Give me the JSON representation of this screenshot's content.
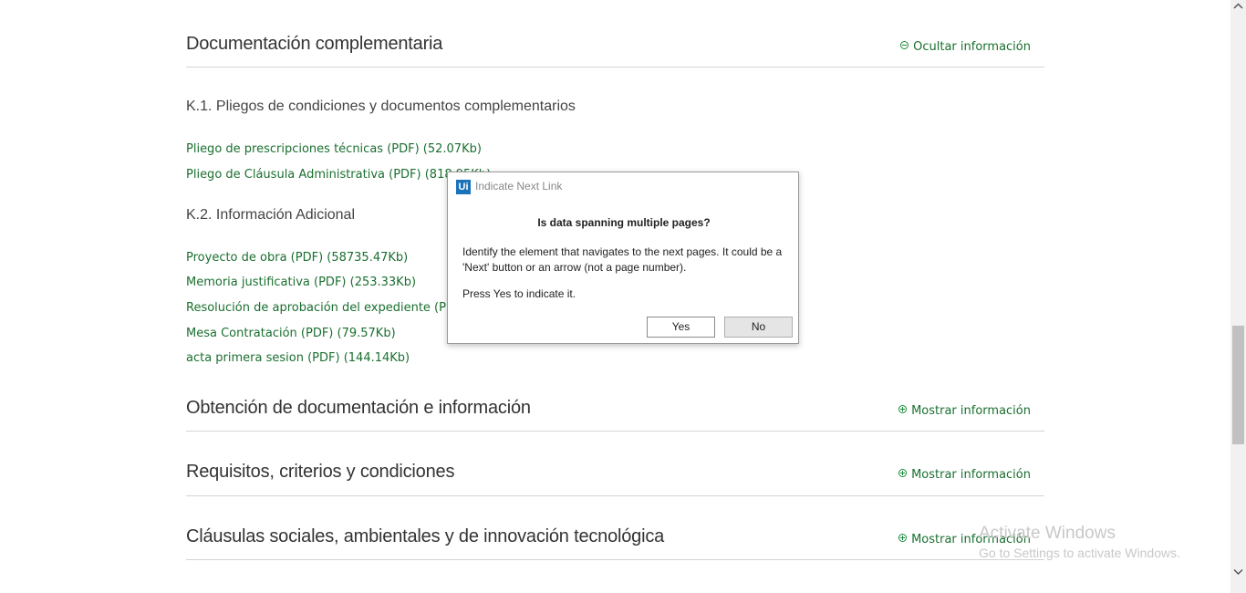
{
  "sections": {
    "documentacion": {
      "title": "Documentación complementaria",
      "toggle": "Ocultar información",
      "k1": {
        "title": "K.1. Pliegos de condiciones y documentos complementarios",
        "links": [
          "Pliego de prescripciones técnicas (PDF) (52.07Kb)",
          "Pliego de Cláusula Administrativa (PDF) (818.95Kb)"
        ]
      },
      "k2": {
        "title": "K.2. Información Adicional",
        "links": [
          "Proyecto de obra (PDF) (58735.47Kb)",
          "Memoria justificativa (PDF) (253.33Kb)",
          "Resolución de aprobación del expediente (PDF)",
          "Mesa Contratación (PDF) (79.57Kb)",
          "acta primera sesion (PDF) (144.14Kb)"
        ]
      }
    },
    "obtencion": {
      "title": "Obtención de documentación e información",
      "toggle": "Mostrar información"
    },
    "requisitos": {
      "title": "Requisitos, criterios y condiciones",
      "toggle": "Mostrar información"
    },
    "clausulas": {
      "title": "Cláusulas sociales, ambientales y de innovación tecnológica",
      "toggle": "Mostrar información"
    }
  },
  "dialog": {
    "logo": "Ui",
    "title": "Indicate Next Link",
    "question": "Is data spanning multiple pages?",
    "body": "Identify the element that navigates to the next pages. It could be a 'Next' button or an arrow (not a page number).",
    "press": "Press Yes to indicate it.",
    "yes_label": "Yes",
    "no_label": "No"
  },
  "watermark": {
    "line1": "Activate Windows",
    "line2": "Go to Settings to activate Windows."
  },
  "colors": {
    "link": "#1a6f2f",
    "accent": "#1a8a3a",
    "dialog_logo": "#1a73b8"
  },
  "icons": {
    "collapse": "minus-circle-icon",
    "expand": "plus-circle-icon"
  }
}
